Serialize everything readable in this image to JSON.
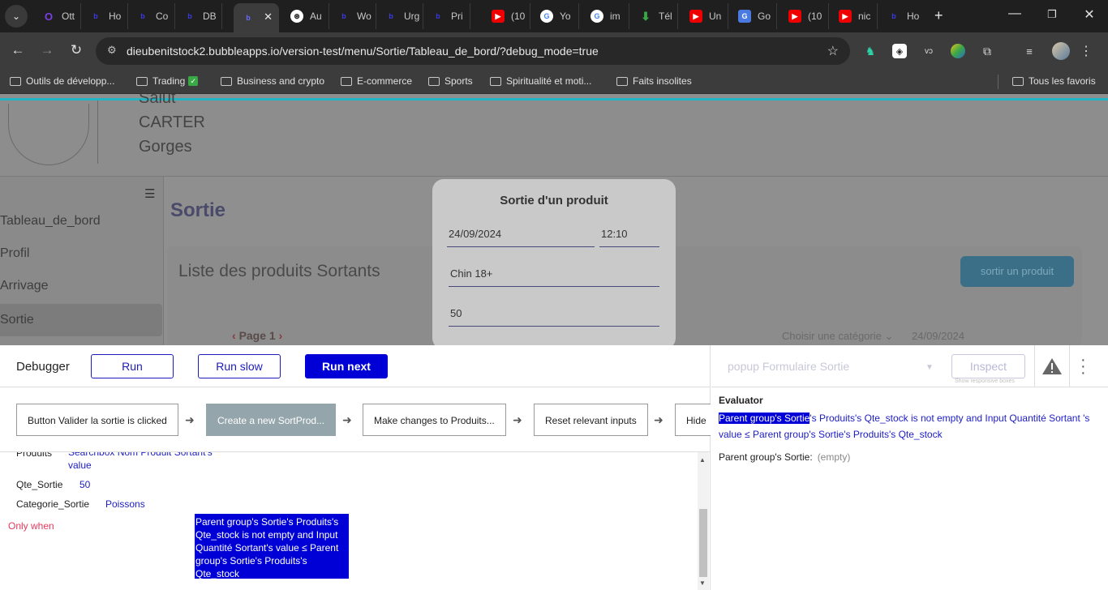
{
  "browser": {
    "tabs": [
      {
        "label": "Ott",
        "favicon": "o",
        "color": "#7b3fe4"
      },
      {
        "label": "Ho",
        "favicon": "b",
        "color": "#3a3ae0"
      },
      {
        "label": "Co",
        "favicon": "b",
        "color": "#3a3ae0"
      },
      {
        "label": "DB",
        "favicon": "b",
        "color": "#3a3ae0"
      },
      {
        "label": "",
        "favicon": "b",
        "color": "#3a3ae0"
      },
      {
        "label": "Au",
        "favicon": "⊛",
        "color": "#444"
      },
      {
        "label": "Wo",
        "favicon": "b",
        "color": "#3a3ae0"
      },
      {
        "label": "Urg",
        "favicon": "b",
        "color": "#3a3ae0"
      },
      {
        "label": "Pri",
        "favicon": "b",
        "color": "#3a3ae0"
      },
      {
        "label": "(10",
        "favicon": "▶",
        "color": "#e00"
      },
      {
        "label": "Yo",
        "favicon": "G",
        "color": "#fff"
      },
      {
        "label": "im",
        "favicon": "G",
        "color": "#fff"
      },
      {
        "label": "Tél",
        "favicon": "⬇",
        "color": "#3aa845"
      },
      {
        "label": "Un",
        "favicon": "▶",
        "color": "#e00"
      },
      {
        "label": "Go",
        "favicon": "G",
        "color": "#4a7ae0"
      },
      {
        "label": "(10",
        "favicon": "▶",
        "color": "#e00"
      },
      {
        "label": "nic",
        "favicon": "▶",
        "color": "#e00"
      },
      {
        "label": "Ho",
        "favicon": "b",
        "color": "#3a3ae0"
      }
    ],
    "url": "dieubenitstock2.bubbleapps.io/version-test/menu/Sortie/Tableau_de_bord/?debug_mode=true",
    "bookmarks": [
      {
        "label": "Outils de développ..."
      },
      {
        "label": "Trading"
      },
      {
        "label": "Business and crypto"
      },
      {
        "label": "E-commerce"
      },
      {
        "label": "Sports"
      },
      {
        "label": "Spiritualité et moti..."
      },
      {
        "label": "Faits insolites"
      }
    ],
    "all_bookmarks": "Tous les favoris"
  },
  "app": {
    "user_lines": [
      "Salut",
      "CARTER",
      "Gorges"
    ],
    "sidebar": [
      {
        "label": "Tableau_de_bord"
      },
      {
        "label": "Profil"
      },
      {
        "label": "Arrivage"
      },
      {
        "label": "Sortie"
      }
    ],
    "page_title": "Sortie",
    "list_title": "Liste des produits Sortants",
    "sortir_button": "sortir un produit",
    "pager": "Page 1",
    "filter_category": "Choisir une catégorie",
    "filter_date": "24/09/2024",
    "popup": {
      "title": "Sortie d'un produit",
      "date": "24/09/2024",
      "time": "12:10",
      "product": "Chin 18+",
      "quantity": "50"
    }
  },
  "debugger": {
    "label": "Debugger",
    "run": "Run",
    "run_slow": "Run slow",
    "run_next": "Run next",
    "steps": [
      "Button Valider la sortie is clicked",
      "Create a new SortProd...",
      "Make changes to Produits...",
      "Reset relevant inputs",
      "Hide"
    ],
    "fields": [
      {
        "key": "Produits",
        "value": "Searchbox Nom Produit Sortant's value"
      },
      {
        "key": "Qte_Sortie",
        "value": "50"
      },
      {
        "key": "Categorie_Sortie",
        "value": "Poissons"
      }
    ],
    "only_when": "Only when",
    "condition": "Parent group's Sortie's Produits's Qte_stock is not empty and Input Quantité Sortant's value ≤ Parent group's Sortie's Produits's Qte_stock",
    "inspect_select": "popup Formulaire Sortie",
    "inspect_button": "Inspect",
    "responsive_hint": "Show responsive boxes",
    "evaluator_title": "Evaluator",
    "eval_highlight": "Parent group's Sortie",
    "eval_rest": "'s Produits's Qte_stock is not empty and Input Quantité Sortant 's value ≤ Parent group's Sortie's Produits's Qte_stock",
    "eval_row_label": "Parent group's Sortie:",
    "eval_row_value": "(empty)"
  },
  "colors": {
    "accent": "#1fb5c4",
    "bubble_blue": "#0000d6",
    "only_when_red": "#e8385c"
  }
}
